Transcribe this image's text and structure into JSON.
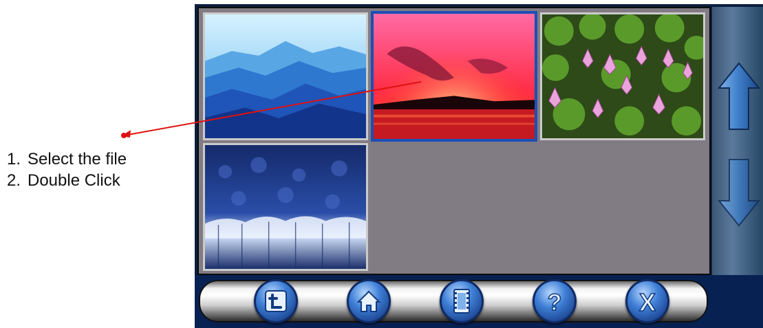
{
  "instructions": [
    {
      "num": "1.",
      "text": "Select the file"
    },
    {
      "num": "2.",
      "text": "Double Click"
    }
  ],
  "thumbnails": [
    {
      "subject": "blue mountain ridges",
      "selected": false
    },
    {
      "subject": "red sunset over water",
      "selected": true
    },
    {
      "subject": "pink water lilies",
      "selected": false
    },
    {
      "subject": "snow-covered forest",
      "selected": false
    }
  ],
  "side_controls": {
    "up": "up-arrow-icon",
    "down": "down-arrow-icon"
  },
  "toolbar_buttons": [
    {
      "icon": "back-icon"
    },
    {
      "icon": "home-icon"
    },
    {
      "icon": "film-icon"
    },
    {
      "icon": "help-icon",
      "glyph": "?"
    },
    {
      "icon": "close-icon",
      "glyph": "X"
    }
  ],
  "colors": {
    "selection_border": "#1b4fb5",
    "callout_arrow": "#e01010",
    "grid_background": "#817b83",
    "toolbar_background": "#082153"
  }
}
